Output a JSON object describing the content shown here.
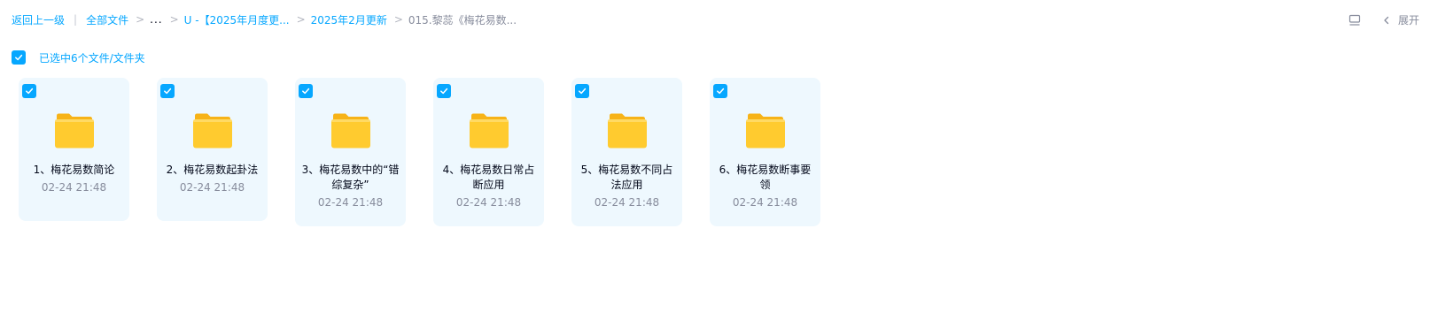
{
  "breadcrumb": {
    "back": "返回上一级",
    "divider": "|",
    "separator": ">",
    "items": [
      {
        "label": "全部文件"
      },
      {
        "label": "..."
      },
      {
        "label": "U -【2025年月度更..."
      },
      {
        "label": "2025年2月更新"
      },
      {
        "label": "015.黎蕊《梅花易数..."
      }
    ]
  },
  "toolbar": {
    "view_icon": "list-view-icon",
    "expand_icon": "chevron-left-icon",
    "expand_label": "展开"
  },
  "selection": {
    "checked": true,
    "label": "已选中6个文件/文件夹"
  },
  "files": [
    {
      "name": "1、梅花易数简论",
      "time": "02-24 21:48",
      "checked": true,
      "icon": "folder-icon"
    },
    {
      "name": "2、梅花易数起卦法",
      "time": "02-24 21:48",
      "checked": true,
      "icon": "folder-icon"
    },
    {
      "name": "3、梅花易数中的“错综复杂”",
      "time": "02-24 21:48",
      "checked": true,
      "icon": "folder-icon"
    },
    {
      "name": "4、梅花易数日常占断应用",
      "time": "02-24 21:48",
      "checked": true,
      "icon": "folder-icon"
    },
    {
      "name": "5、梅花易数不同占法应用",
      "time": "02-24 21:48",
      "checked": true,
      "icon": "folder-icon"
    },
    {
      "name": "6、梅花易数断事要领",
      "time": "02-24 21:48",
      "checked": true,
      "icon": "folder-icon"
    }
  ],
  "colors": {
    "accent": "#06a7ff",
    "card_selected_bg": "#eef8fe",
    "folder_front": "#ffcb2f",
    "folder_back": "#f7b318",
    "text_primary": "#03081a",
    "text_secondary": "#878c9c"
  }
}
